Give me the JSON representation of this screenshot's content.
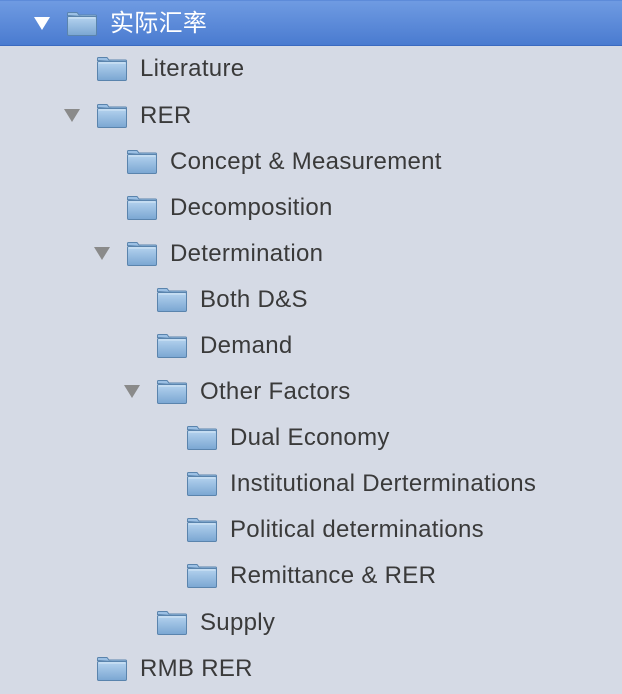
{
  "tree": {
    "items": [
      {
        "label": "实际汇率",
        "level": 0,
        "expanded": true,
        "selected": true,
        "name": "tree-item-real-exchange-rate"
      },
      {
        "label": "Literature",
        "level": 1,
        "expanded": false,
        "name": "tree-item-literature"
      },
      {
        "label": "RER",
        "level": 1,
        "expanded": true,
        "name": "tree-item-rer"
      },
      {
        "label": "Concept & Measurement",
        "level": 2,
        "expanded": false,
        "name": "tree-item-concept-measurement"
      },
      {
        "label": "Decomposition",
        "level": 2,
        "expanded": false,
        "name": "tree-item-decomposition"
      },
      {
        "label": "Determination",
        "level": 2,
        "expanded": true,
        "name": "tree-item-determination"
      },
      {
        "label": "Both D&S",
        "level": 3,
        "expanded": false,
        "name": "tree-item-both-ds"
      },
      {
        "label": "Demand",
        "level": 3,
        "expanded": false,
        "name": "tree-item-demand"
      },
      {
        "label": "Other Factors",
        "level": 3,
        "expanded": true,
        "name": "tree-item-other-factors"
      },
      {
        "label": "Dual Economy",
        "level": 4,
        "expanded": false,
        "name": "tree-item-dual-economy"
      },
      {
        "label": "Institutional Derterminations",
        "level": 4,
        "expanded": false,
        "name": "tree-item-institutional-derterminations"
      },
      {
        "label": "Political determinations",
        "level": 4,
        "expanded": false,
        "name": "tree-item-political-determinations"
      },
      {
        "label": "Remittance & RER",
        "level": 4,
        "expanded": false,
        "name": "tree-item-remittance-rer"
      },
      {
        "label": "Supply",
        "level": 3,
        "expanded": false,
        "name": "tree-item-supply"
      },
      {
        "label": "RMB RER",
        "level": 1,
        "expanded": false,
        "name": "tree-item-rmb-rer"
      }
    ]
  },
  "colors": {
    "background": "#d5dae5",
    "selection": "#4a7bd0",
    "text": "#3a3a3a",
    "selected_text": "#ffffff",
    "disclosure": "#8a8a8a",
    "folder_fill": "#8cb6dc",
    "folder_edge": "#5a84ad"
  },
  "icons": {
    "folder": "folder-icon",
    "expanded_disclosure": "disclosure-triangle-down-icon"
  }
}
